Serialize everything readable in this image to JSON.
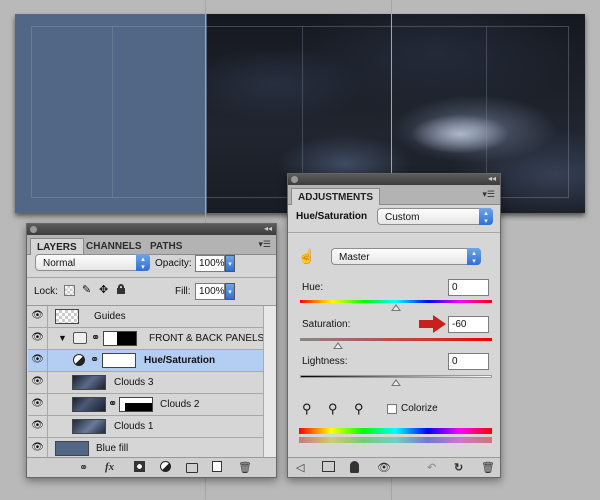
{
  "layers_panel": {
    "tabs": [
      "LAYERS",
      "CHANNELS",
      "PATHS"
    ],
    "blend_mode": "Normal",
    "opacity_label": "Opacity:",
    "opacity_value": "100%",
    "lock_label": "Lock:",
    "fill_label": "Fill:",
    "fill_value": "100%",
    "layers": [
      {
        "name": "Guides",
        "visible": true,
        "selected": false
      },
      {
        "name": "FRONT & BACK PANELS",
        "visible": true,
        "selected": false,
        "group": true
      },
      {
        "name": "Hue/Saturation",
        "visible": true,
        "selected": true,
        "adjustment": true
      },
      {
        "name": "Clouds 3",
        "visible": true,
        "selected": false
      },
      {
        "name": "Clouds 2",
        "visible": true,
        "selected": false
      },
      {
        "name": "Clouds 1",
        "visible": true,
        "selected": false
      },
      {
        "name": "Blue fill",
        "visible": true,
        "selected": false
      }
    ],
    "footer_icons": [
      "link-icon",
      "fx-icon",
      "mask-icon",
      "adjustment-icon",
      "folder-icon",
      "new-layer-icon",
      "trash-icon"
    ],
    "footer_fx": "fx"
  },
  "adjustments_panel": {
    "tab": "ADJUSTMENTS",
    "adjustment_type": "Hue/Saturation",
    "preset": "Custom",
    "channel": "Master",
    "hue_label": "Hue:",
    "hue_value": "0",
    "saturation_label": "Saturation:",
    "saturation_value": "-60",
    "lightness_label": "Lightness:",
    "lightness_value": "0",
    "colorize_label": "Colorize",
    "colorize_checked": false,
    "slider_levels": {
      "hue": 0.5,
      "saturation": 0.2,
      "lightness": 0.5
    }
  },
  "colors": {
    "guide": "#37d4dd",
    "canvas_blue": "#516785",
    "selection": "#b3cdf3",
    "arrow": "#c8201c"
  }
}
